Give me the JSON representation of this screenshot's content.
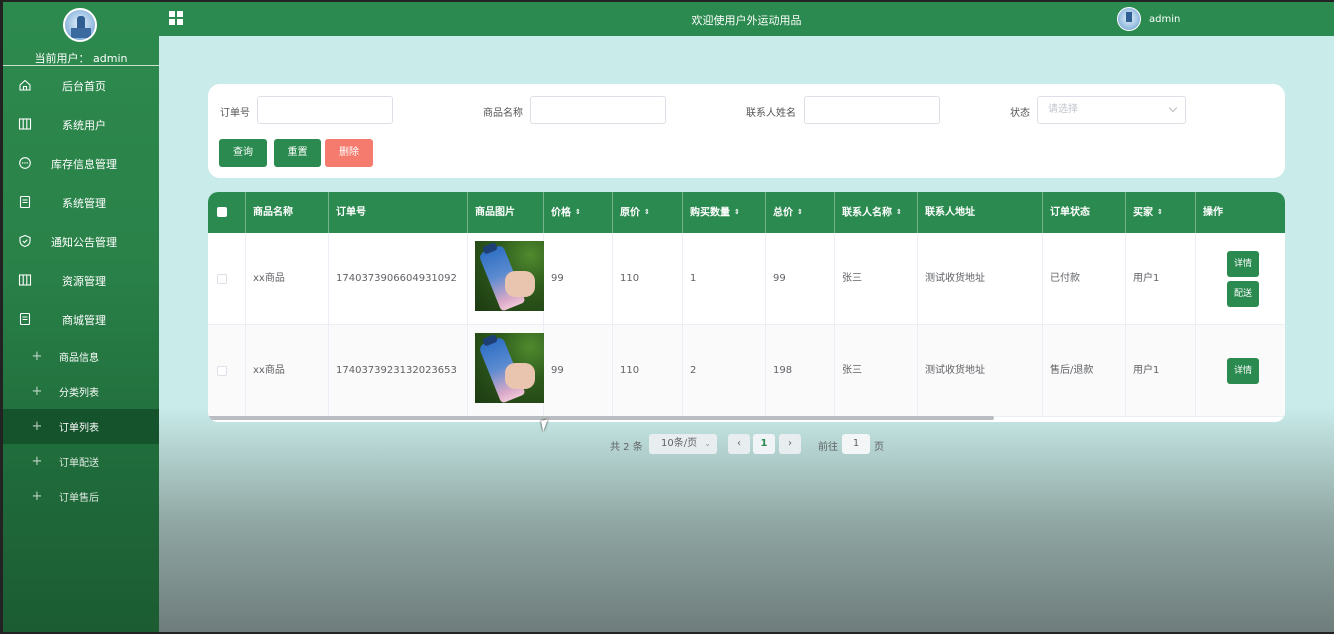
{
  "sidebar": {
    "current_user": "当前用户：  admin",
    "menu": [
      {
        "label": "后台首页",
        "icon": "home-icon"
      },
      {
        "label": "系统用户",
        "icon": "columns-icon"
      },
      {
        "label": "库存信息管理",
        "icon": "chat-icon"
      },
      {
        "label": "系统管理",
        "icon": "document-icon"
      },
      {
        "label": "通知公告管理",
        "icon": "shield-icon"
      },
      {
        "label": "资源管理",
        "icon": "columns-icon"
      },
      {
        "label": "商城管理",
        "icon": "document-icon"
      }
    ],
    "submenu": [
      {
        "label": "商品信息"
      },
      {
        "label": "分类列表"
      },
      {
        "label": "订单列表",
        "active": true
      },
      {
        "label": "订单配送"
      },
      {
        "label": "订单售后"
      }
    ]
  },
  "header": {
    "title": "欢迎使用户外运动用品",
    "user": "admin"
  },
  "search": {
    "order_no_label": "订单号",
    "product_name_label": "商品名称",
    "contact_name_label": "联系人姓名",
    "status_label": "状态",
    "status_placeholder": "请选择",
    "query_button": "查询",
    "reset_button": "重置",
    "delete_button": "删除"
  },
  "table": {
    "columns": [
      "商品名称",
      "订单号",
      "商品图片",
      "价格",
      "原价",
      "购买数量",
      "总价",
      "联系人名称",
      "联系人地址",
      "订单状态",
      "买家",
      "操作"
    ],
    "rows": [
      {
        "product": "xx商品",
        "order_no": "1740373906604931092",
        "price": "99",
        "original_price": "110",
        "qty": "1",
        "total": "99",
        "contact": "张三",
        "address": "测试收货地址",
        "status": "已付款",
        "buyer": "用户1",
        "actions": [
          "详情",
          "配送"
        ]
      },
      {
        "product": "xx商品",
        "order_no": "1740373923132023653",
        "price": "99",
        "original_price": "110",
        "qty": "2",
        "total": "198",
        "contact": "张三",
        "address": "测试收货地址",
        "status": "售后/退款",
        "buyer": "用户1",
        "actions": [
          "详情"
        ]
      }
    ]
  },
  "pagination": {
    "total": "共 2 条",
    "page_size": "10条/页",
    "current_page": "1",
    "goto_label": "前往",
    "goto_value": "1",
    "page_suffix": "页"
  },
  "colors": {
    "primary": "#2b8a4f",
    "danger": "#f47b6e",
    "background": "#c9ecea"
  }
}
